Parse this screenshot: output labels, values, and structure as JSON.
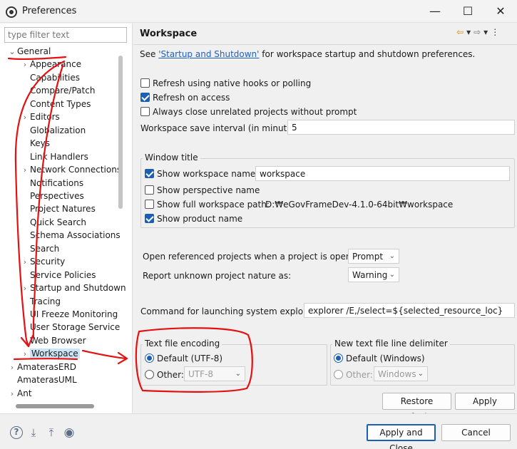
{
  "window": {
    "title": "Preferences",
    "minimize": "—",
    "maximize": "☐",
    "close": "✕"
  },
  "sidebar": {
    "filter_placeholder": "type filter text",
    "items": [
      {
        "label": "General",
        "expander": "⌄",
        "level": 0
      },
      {
        "label": "Appearance",
        "expander": "›",
        "level": 1
      },
      {
        "label": "Capabilities",
        "expander": "",
        "level": 1
      },
      {
        "label": "Compare/Patch",
        "expander": "",
        "level": 1
      },
      {
        "label": "Content Types",
        "expander": "",
        "level": 1
      },
      {
        "label": "Editors",
        "expander": "›",
        "level": 1
      },
      {
        "label": "Globalization",
        "expander": "",
        "level": 1
      },
      {
        "label": "Keys",
        "expander": "",
        "level": 1
      },
      {
        "label": "Link Handlers",
        "expander": "",
        "level": 1
      },
      {
        "label": "Network Connections",
        "expander": "›",
        "level": 1
      },
      {
        "label": "Notifications",
        "expander": "",
        "level": 1
      },
      {
        "label": "Perspectives",
        "expander": "",
        "level": 1
      },
      {
        "label": "Project Natures",
        "expander": "",
        "level": 1
      },
      {
        "label": "Quick Search",
        "expander": "",
        "level": 1
      },
      {
        "label": "Schema Associations",
        "expander": "",
        "level": 1
      },
      {
        "label": "Search",
        "expander": "",
        "level": 1
      },
      {
        "label": "Security",
        "expander": "›",
        "level": 1
      },
      {
        "label": "Service Policies",
        "expander": "",
        "level": 1
      },
      {
        "label": "Startup and Shutdown",
        "expander": "›",
        "level": 1
      },
      {
        "label": "Tracing",
        "expander": "",
        "level": 1
      },
      {
        "label": "UI Freeze Monitoring",
        "expander": "",
        "level": 1
      },
      {
        "label": "User Storage Service",
        "expander": "›",
        "level": 1
      },
      {
        "label": "Web Browser",
        "expander": "",
        "level": 1
      },
      {
        "label": "Workspace",
        "expander": "›",
        "level": 1
      },
      {
        "label": "AmaterasERD",
        "expander": "›",
        "level": 0
      },
      {
        "label": "AmaterasUML",
        "expander": "",
        "level": 0
      },
      {
        "label": "Ant",
        "expander": "›",
        "level": 0
      }
    ]
  },
  "page": {
    "title": "Workspace",
    "see_prefix": "See ",
    "see_link": "'Startup and Shutdown'",
    "see_suffix": " for workspace startup and shutdown preferences.",
    "options": {
      "refresh_native": {
        "label": "Refresh using native hooks or polling",
        "checked": false
      },
      "refresh_access": {
        "label": "Refresh on access",
        "checked": true
      },
      "always_close": {
        "label": "Always close unrelated projects without prompt",
        "checked": false
      }
    },
    "save_interval_label": "Workspace save interval (in minutes):",
    "save_interval_value": "5",
    "window_title": {
      "legend": "Window title",
      "show_workspace_name": "Show workspace name:",
      "workspace_name_value": "workspace",
      "show_perspective_name": "Show perspective name",
      "show_full_path": "Show full workspace path:",
      "full_path_value": "D:₩eGovFrameDev-4.1.0-64bit₩workspace",
      "show_product_name": "Show product name"
    },
    "open_referenced_label": "Open referenced projects when a project is opened:",
    "open_referenced_value": "Prompt",
    "report_unknown_label": "Report unknown project nature as:",
    "report_unknown_value": "Warning",
    "explorer_label": "Command for launching system explorer:",
    "explorer_value": "explorer /E,/select=${selected_resource_loc}",
    "encoding": {
      "legend": "Text file encoding",
      "default_label": "Default (UTF-8)",
      "other_label": "Other:",
      "other_value": "UTF-8"
    },
    "delimiter": {
      "legend": "New text file line delimiter",
      "default_label": "Default (Windows)",
      "other_label": "Other:",
      "other_value": "Windows"
    },
    "restore_defaults": "Restore Defaults",
    "apply": "Apply"
  },
  "footer": {
    "apply_close": "Apply and Close",
    "cancel": "Cancel",
    "icons": [
      "help-icon",
      "import-icon",
      "export-icon",
      "record-icon"
    ]
  },
  "colors": {
    "accent": "#1a5fb4",
    "annotation": "#e31212",
    "link": "#1f5fbf"
  }
}
